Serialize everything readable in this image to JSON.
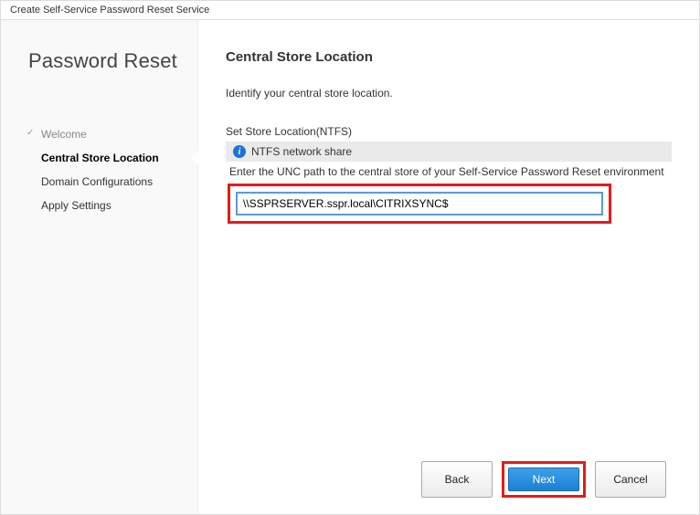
{
  "window": {
    "title": "Create Self-Service Password Reset Service"
  },
  "sidebar": {
    "heading": "Password Reset",
    "steps": [
      {
        "label": "Welcome"
      },
      {
        "label": "Central Store Location"
      },
      {
        "label": "Domain Configurations"
      },
      {
        "label": "Apply Settings"
      }
    ]
  },
  "main": {
    "title": "Central Store Location",
    "description": "Identify your central store location.",
    "section_label": "Set Store Location(NTFS)",
    "ntfs_label": "NTFS network share",
    "hint": "Enter the UNC path to the central store of your Self-Service Password Reset environment",
    "unc_value": "\\\\SSPRSERVER.sspr.local\\CITRIXSYNC$"
  },
  "footer": {
    "back_label": "Back",
    "next_label": "Next",
    "cancel_label": "Cancel"
  }
}
